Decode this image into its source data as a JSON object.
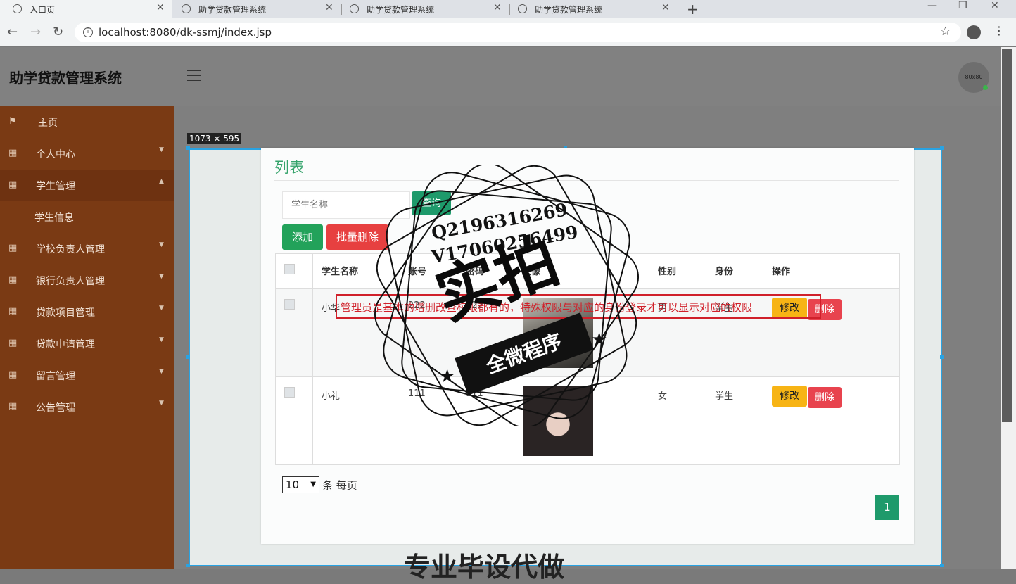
{
  "browser": {
    "tabs": [
      {
        "label": "入口页"
      },
      {
        "label": "助学贷款管理系统"
      },
      {
        "label": "助学贷款管理系统"
      },
      {
        "label": "助学贷款管理系统"
      }
    ],
    "url": "localhost:8080/dk-ssmj/index.jsp"
  },
  "header": {
    "title": "助学贷款管理系统",
    "avatar_text": "80x80"
  },
  "sidebar": {
    "items": [
      {
        "label": "主页",
        "icon": "flag-icon"
      },
      {
        "label": "个人中心",
        "icon": "grid-icon"
      },
      {
        "label": "学生管理",
        "icon": "grid-icon"
      },
      {
        "label": "学生信息"
      },
      {
        "label": "学校负责人管理",
        "icon": "grid-icon"
      },
      {
        "label": "银行负责人管理",
        "icon": "grid-icon"
      },
      {
        "label": "贷款项目管理",
        "icon": "grid-icon"
      },
      {
        "label": "贷款申请管理",
        "icon": "grid-icon"
      },
      {
        "label": "留言管理",
        "icon": "grid-icon"
      },
      {
        "label": "公告管理",
        "icon": "grid-icon"
      }
    ]
  },
  "overlay": {
    "size_badge": "1073 × 595",
    "annotation": "管理员是基本的增删改查权限都有的，特殊权限与对应的身份登录才可以显示对应的权限",
    "watermark_contact_1": "Q2196316269",
    "watermark_contact_2": "V17060256499",
    "watermark_big": "实拍",
    "watermark_ribbon": "全微程序",
    "watermark_bottom": "专业毕设代做"
  },
  "main": {
    "title": "列表",
    "search_placeholder": "学生名称",
    "query_label": "查询",
    "add_label": "添加",
    "batch_delete_label": "批量删除",
    "table": {
      "headers": [
        "学生名称",
        "账号",
        "密码",
        "头像",
        "性别",
        "身份",
        "操作"
      ],
      "rows": [
        {
          "name": "小华",
          "account": "222",
          "password": "222",
          "gender": "男",
          "identity": "学生"
        },
        {
          "name": "小礼",
          "account": "111",
          "password": "111",
          "gender": "女",
          "identity": "学生"
        }
      ],
      "edit_label": "修改",
      "delete_label": "删除"
    },
    "pager": {
      "page_size": "10",
      "per_page_text": "条 每页",
      "current_page": "1"
    }
  },
  "colors": {
    "sidebar": "#7a3a14",
    "accent_green": "#1e9a6b",
    "danger": "#e74040",
    "warning": "#f7b415"
  }
}
